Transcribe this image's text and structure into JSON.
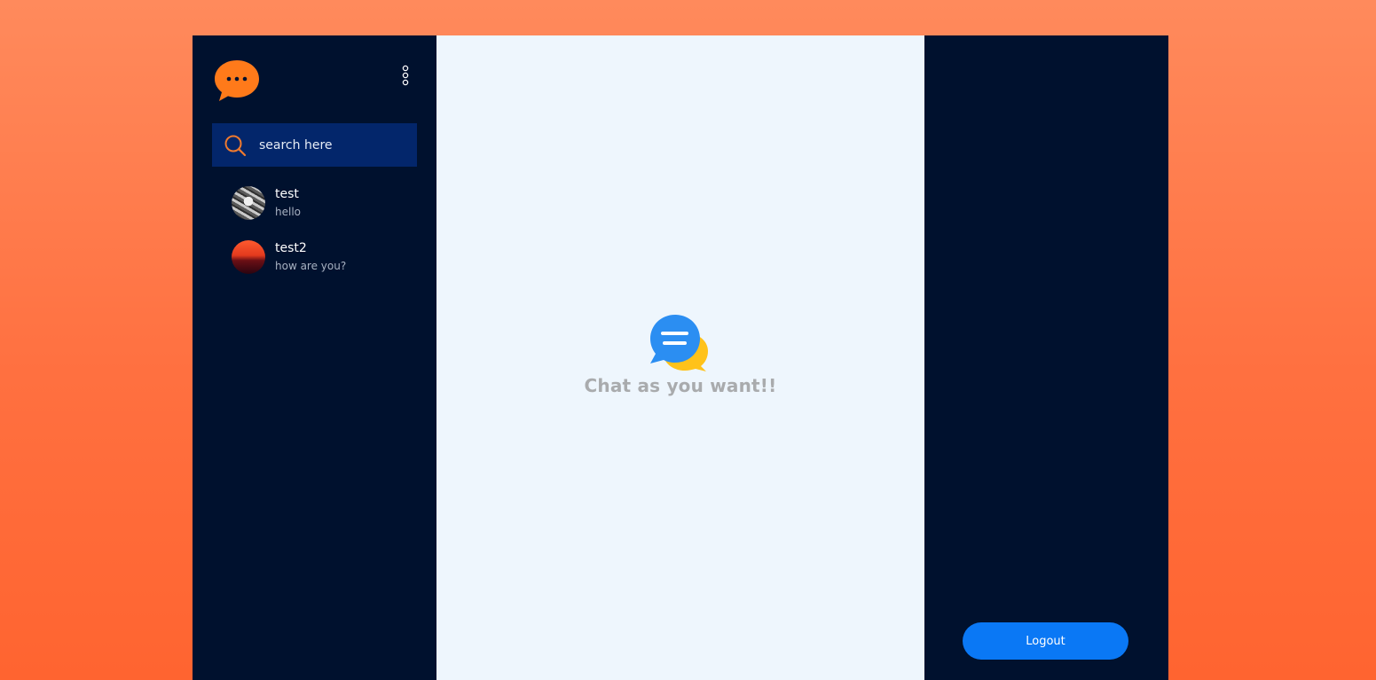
{
  "sidebar": {
    "logo_icon": "speech-bubble-dots-icon",
    "menu_icon": "vertical-dots-icon",
    "search": {
      "placeholder": "search here",
      "icon": "search-icon"
    },
    "contacts": [
      {
        "name": "test",
        "last_message": "hello"
      },
      {
        "name": "test2",
        "last_message": "how are you?"
      }
    ]
  },
  "main": {
    "welcome_icon": "chat-bubbles-icon",
    "welcome_text": "Chat as you want!!"
  },
  "right_panel": {
    "logout_label": "Logout"
  },
  "colors": {
    "page_background": "#ff7a4a",
    "panel_background": "#00112e",
    "search_background": "#03266b",
    "main_background": "#eef6fd",
    "accent_orange": "#ff7a1a",
    "logout_button": "#0a78f5",
    "welcome_text": "#a9abad"
  }
}
